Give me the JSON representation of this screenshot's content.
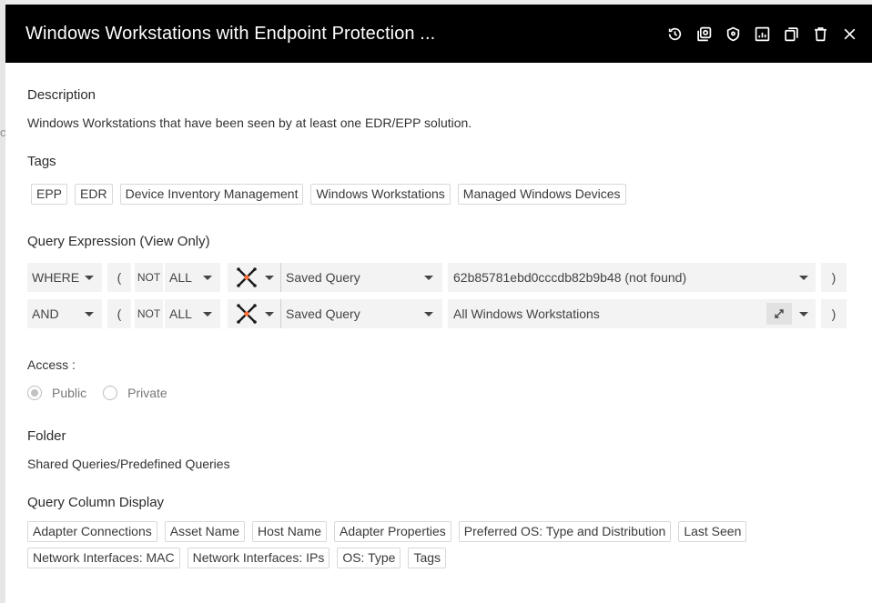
{
  "background": {
    "fragment": "co"
  },
  "header": {
    "title": "Windows Workstations with Endpoint Protection ...",
    "actions": [
      "history-icon",
      "duplicate-icon",
      "shield-icon",
      "dashboard-chart-icon",
      "copy-icon",
      "trash-icon",
      "close-icon"
    ]
  },
  "description": {
    "title": "Description",
    "text": "Windows Workstations that have been seen by at least one EDR/EPP solution."
  },
  "tags": {
    "title": "Tags",
    "items": [
      "EPP",
      "EDR",
      "Device Inventory Management",
      "Windows Workstations",
      "Managed Windows Devices"
    ]
  },
  "query": {
    "title": "Query Expression (View Only)",
    "rows": [
      {
        "logic": "WHERE",
        "open_paren": "(",
        "not": "NOT",
        "scope": "ALL",
        "field": "Saved Query",
        "value": "62b85781ebd0cccdb82b9b48 (not found)",
        "close_paren": ")"
      },
      {
        "logic": "AND",
        "open_paren": "(",
        "not": "NOT",
        "scope": "ALL",
        "field": "Saved Query",
        "value": "All Windows Workstations",
        "close_paren": ")"
      }
    ]
  },
  "access": {
    "label": "Access :",
    "options": [
      {
        "label": "Public",
        "selected": true
      },
      {
        "label": "Private",
        "selected": false
      }
    ]
  },
  "folder": {
    "title": "Folder",
    "path": "Shared Queries/Predefined Queries"
  },
  "columns": {
    "title": "Query Column Display",
    "items": [
      "Adapter Connections",
      "Asset Name",
      "Host Name",
      "Adapter Properties",
      "Preferred OS: Type and Distribution",
      "Last Seen",
      "Network Interfaces: MAC",
      "Network Interfaces: IPs",
      "OS: Type",
      "Tags"
    ]
  },
  "colors": {
    "header_bg": "#000000",
    "accent": "#ff6b35",
    "cell_bg": "#f3f3f3"
  }
}
